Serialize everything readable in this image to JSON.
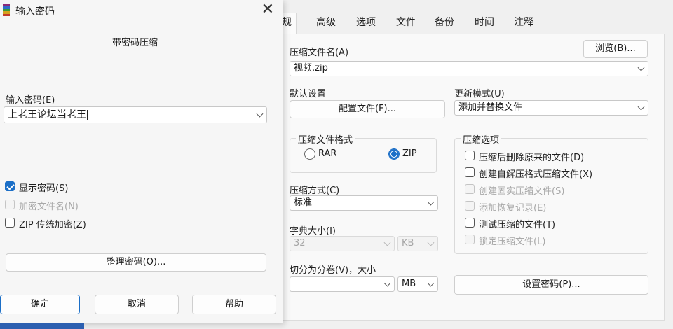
{
  "tabs": [
    {
      "label": "常规",
      "shown": "规"
    },
    {
      "label": "高级"
    },
    {
      "label": "选项"
    },
    {
      "label": "文件"
    },
    {
      "label": "备份"
    },
    {
      "label": "时间"
    },
    {
      "label": "注释"
    }
  ],
  "general": {
    "archive_name_label": "压缩文件名(A)",
    "browse_button": "浏览(B)...",
    "archive_name_value": "视频.zip",
    "default_settings_label": "默认设置",
    "profiles_button": "配置文件(F)...",
    "update_mode_label": "更新模式(U)",
    "update_mode_value": "添加并替换文件",
    "archive_format_title": "压缩文件格式",
    "format_rar": "RAR",
    "format_zip": "ZIP",
    "selected_format": "ZIP",
    "method_label": "压缩方式(C)",
    "method_value": "标准",
    "dict_label": "字典大小(I)",
    "dict_value": "32",
    "dict_unit": "KB",
    "split_label": "切分为分卷(V)，大小",
    "split_value": "",
    "split_unit": "MB",
    "set_password_button": "设置密码(P)...",
    "options_title": "压缩选项",
    "options": [
      {
        "label": "压缩后删除原来的文件(D)",
        "checked": false,
        "enabled": true
      },
      {
        "label": "创建自解压格式压缩文件(X)",
        "checked": false,
        "enabled": true
      },
      {
        "label": "创建固实压缩文件(S)",
        "checked": false,
        "enabled": false
      },
      {
        "label": "添加恢复记录(E)",
        "checked": false,
        "enabled": false
      },
      {
        "label": "测试压缩的文件(T)",
        "checked": false,
        "enabled": true
      },
      {
        "label": "锁定压缩文件(L)",
        "checked": false,
        "enabled": false
      }
    ]
  },
  "dialog": {
    "title": "输入密码",
    "subtitle": "带密码压缩",
    "password_label": "输入密码(E)",
    "password_value": "上老王论坛当老王",
    "checkboxes": [
      {
        "label": "显示密码(S)",
        "checked": true,
        "enabled": true
      },
      {
        "label": "加密文件名(N)",
        "checked": false,
        "enabled": false
      },
      {
        "label": "ZIP 传统加密(Z)",
        "checked": false,
        "enabled": true
      }
    ],
    "organize_button": "整理密码(O)...",
    "ok_button": "确定",
    "cancel_button": "取消",
    "help_button": "帮助"
  },
  "colors": {
    "accent": "#1c6fc7",
    "disabled_text": "#a8a8a8"
  },
  "icons": {
    "app": "winrar-books-icon",
    "close": "close-icon",
    "dropdown": "chevron-down-icon"
  }
}
